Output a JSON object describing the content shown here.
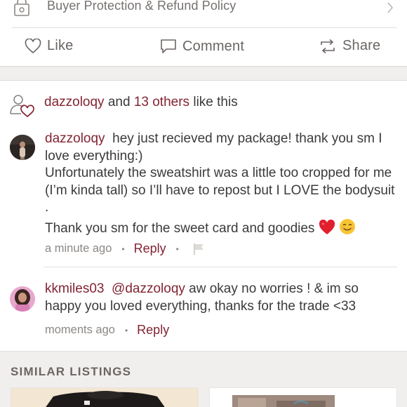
{
  "buyer_protection": {
    "label": "Buyer Protection & Refund Policy",
    "icon": "lock-icon"
  },
  "actions": {
    "like": "Like",
    "comment": "Comment",
    "share": "Share"
  },
  "likes": {
    "user": "dazzoloqy",
    "connector": "and",
    "others": "13 others",
    "suffix": "like this"
  },
  "comments": [
    {
      "username": "dazzoloqy",
      "line1": "hey just recieved my package! thank you sm I love everything:)",
      "line2": "Unfortunately the sweatshirt was a little too cropped for me (I’m kinda tall) so I’ll have to repost but I LOVE the bodysuit .",
      "line3": "Thank you sm for the sweet card and goodies",
      "time": "a minute ago",
      "reply": "Reply"
    },
    {
      "username": "kkmiles03",
      "mention": "@dazzoloqy",
      "text": "aw okay no worries ! & im so happy you loved everything, thanks for the trade <33",
      "time": "moments ago",
      "reply": "Reply"
    }
  ],
  "similar_listings": {
    "title": "SIMILAR LISTINGS"
  },
  "colors": {
    "accent": "#822432",
    "muted": "#8c8784",
    "band": "#f1efee"
  }
}
